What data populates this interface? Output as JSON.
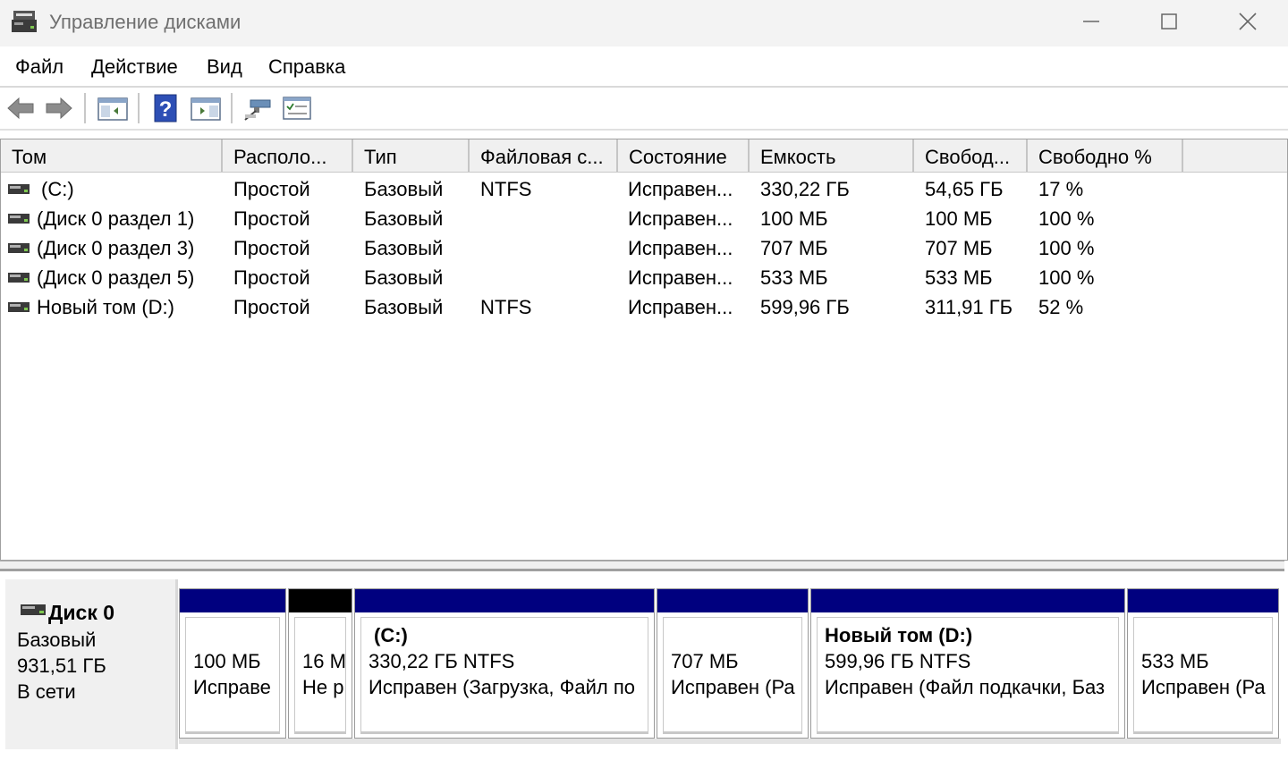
{
  "window": {
    "title": "Управление дисками",
    "icon": "disk-management-icon"
  },
  "menu": {
    "items": [
      "Файл",
      "Действие",
      "Вид",
      "Справка"
    ]
  },
  "toolbar": {
    "icons": [
      "back-arrow-icon",
      "forward-arrow-icon",
      "console-tree-icon",
      "help-icon",
      "action-pane-icon",
      "connect-icon",
      "properties-icon"
    ]
  },
  "volumes": {
    "columns": [
      "Том",
      "Располо...",
      "Тип",
      "Файловая с...",
      "Состояние",
      "Емкость",
      "Свобод...",
      "Свободно %"
    ],
    "rows": [
      [
        "(C:)",
        "Простой",
        "Базовый",
        "NTFS",
        "Исправен...",
        "330,22 ГБ",
        "54,65 ГБ",
        "17 %"
      ],
      [
        "(Диск 0 раздел 1)",
        "Простой",
        "Базовый",
        "",
        "Исправен...",
        "100 МБ",
        "100 МБ",
        "100 %"
      ],
      [
        "(Диск 0 раздел 3)",
        "Простой",
        "Базовый",
        "",
        "Исправен...",
        "707 МБ",
        "707 МБ",
        "100 %"
      ],
      [
        "(Диск 0 раздел 5)",
        "Простой",
        "Базовый",
        "",
        "Исправен...",
        "533 МБ",
        "533 МБ",
        "100 %"
      ],
      [
        "Новый том (D:)",
        "Простой",
        "Базовый",
        "NTFS",
        "Исправен...",
        "599,96 ГБ",
        "311,91 ГБ",
        "52 %"
      ]
    ]
  },
  "disk": {
    "name": "Диск 0",
    "type": "Базовый",
    "size": "931,51 ГБ",
    "status": "В сети",
    "colors": {
      "primary": "#00007f",
      "unallocated": "#000000"
    },
    "partitions": [
      {
        "title": "",
        "line1": "100 МБ",
        "line2": "Исправе",
        "bar": "primary"
      },
      {
        "title": "",
        "line1": "16 М",
        "line2": "Не р",
        "bar": "unallocated"
      },
      {
        "title": "(C:)",
        "line1": "330,22 ГБ NTFS",
        "line2": "Исправен (Загрузка, Файл по",
        "bar": "primary"
      },
      {
        "title": "",
        "line1": "707 МБ",
        "line2": "Исправен (Ра",
        "bar": "primary"
      },
      {
        "title": "Новый том  (D:)",
        "line1": "599,96 ГБ NTFS",
        "line2": "Исправен (Файл подкачки, Баз",
        "bar": "primary"
      },
      {
        "title": "",
        "line1": "533 МБ",
        "line2": "Исправен (Ра",
        "bar": "primary"
      }
    ]
  }
}
